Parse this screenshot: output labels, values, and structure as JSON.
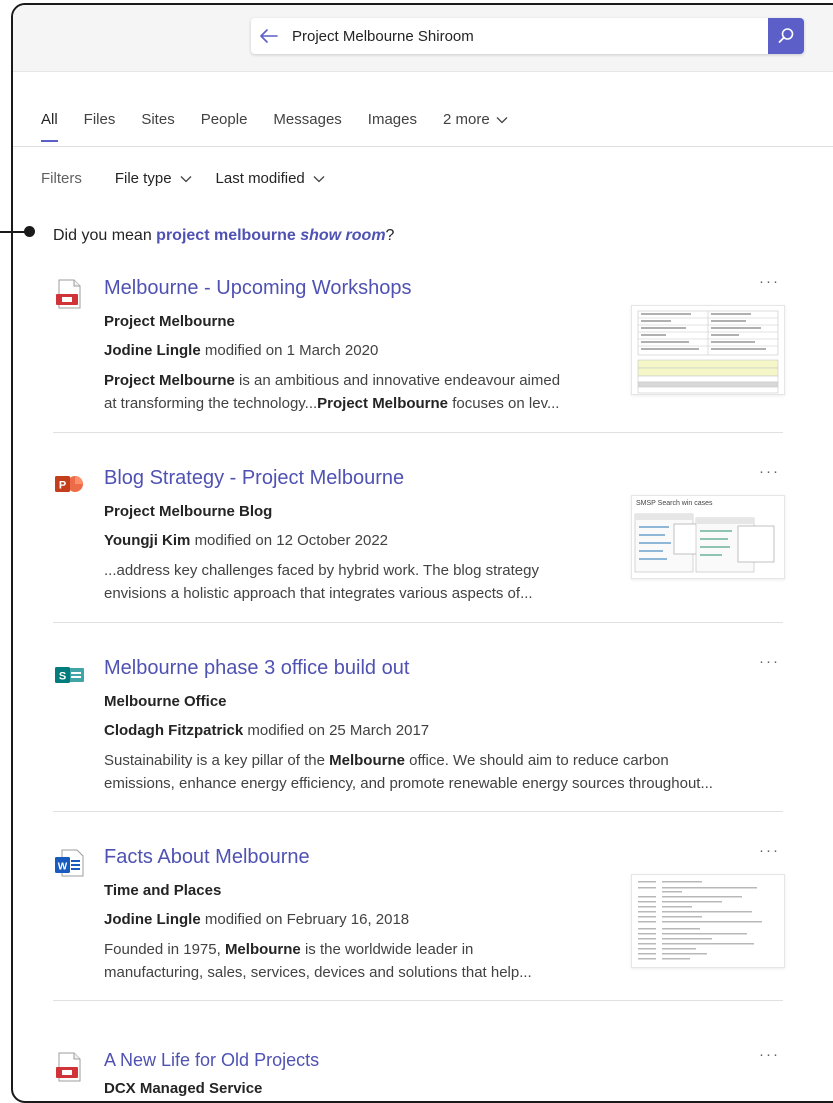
{
  "search": {
    "query": "Project Melbourne Shiroom"
  },
  "tabs": [
    {
      "label": "All",
      "active": true
    },
    {
      "label": "Files"
    },
    {
      "label": "Sites"
    },
    {
      "label": "People"
    },
    {
      "label": "Messages"
    },
    {
      "label": "Images"
    },
    {
      "label": "2 more"
    }
  ],
  "filters": {
    "label": "Filters",
    "file_type": "File type",
    "last_modified": "Last modified"
  },
  "did_you_mean": {
    "prefix": "Did you mean",
    "suggestion_plain": "project melbourne",
    "suggestion_italic": "show room",
    "suffix": "?"
  },
  "results": [
    {
      "icon": "file-pdf-icon",
      "title": "Melbourne - Upcoming Workshops",
      "site": "Project Melbourne",
      "author": "Jodine Lingle",
      "modified": "modified on 1 March 2020",
      "snippet_line1": [
        "Project Melbourne",
        " is an ambitious and innovative endeavour aimed"
      ],
      "snippet_line2": [
        "at transforming the technology...",
        "Project Melbourne",
        " focuses on lev..."
      ],
      "more": "···"
    },
    {
      "icon": "powerpoint-icon",
      "icon_letter": "P",
      "title": "Blog Strategy - Project Melbourne",
      "site": "Project Melbourne Blog",
      "author": "Youngji Kim",
      "modified": "modified on 12 October 2022",
      "snippet_line1": "...address key challenges faced by hybrid work. The blog strategy",
      "snippet_line2": "envisions a holistic approach that integrates various aspects of...",
      "thumb_title": "SMSP Search win cases",
      "more": "···"
    },
    {
      "icon": "sharepoint-icon",
      "icon_letter": "S",
      "title": "Melbourne phase 3 office build out",
      "site": "Melbourne Office",
      "author": "Clodagh Fitzpatrick",
      "modified": "modified on 25 March 2017",
      "snippet_line1": [
        "Sustainability is a key pillar of the ",
        "Melbourne",
        " office. We should aim to reduce carbon"
      ],
      "snippet_line2": "emissions, enhance energy efficiency, and promote renewable energy sources throughout...",
      "more": "···"
    },
    {
      "icon": "word-icon",
      "icon_letter": "W",
      "title": "Facts About Melbourne",
      "site": "Time and Places",
      "author": "Jodine Lingle",
      "modified": "modified on February 16, 2018",
      "snippet_line1": [
        "Founded in 1975, ",
        "Melbourne",
        " is the worldwide leader in"
      ],
      "snippet_line2": "manufacturing, sales, services, devices and solutions that help...",
      "more": "···"
    },
    {
      "icon": "file-pdf-icon",
      "title": "A New Life for Old Projects",
      "site": "DCX Managed Service",
      "more": "···"
    }
  ],
  "colors": {
    "accent": "#5b5fc7",
    "link": "#4f52b2",
    "pdf": "#d13438",
    "ppt": "#c43e1c",
    "sharepoint": "#037c7d",
    "word": "#185abd"
  }
}
